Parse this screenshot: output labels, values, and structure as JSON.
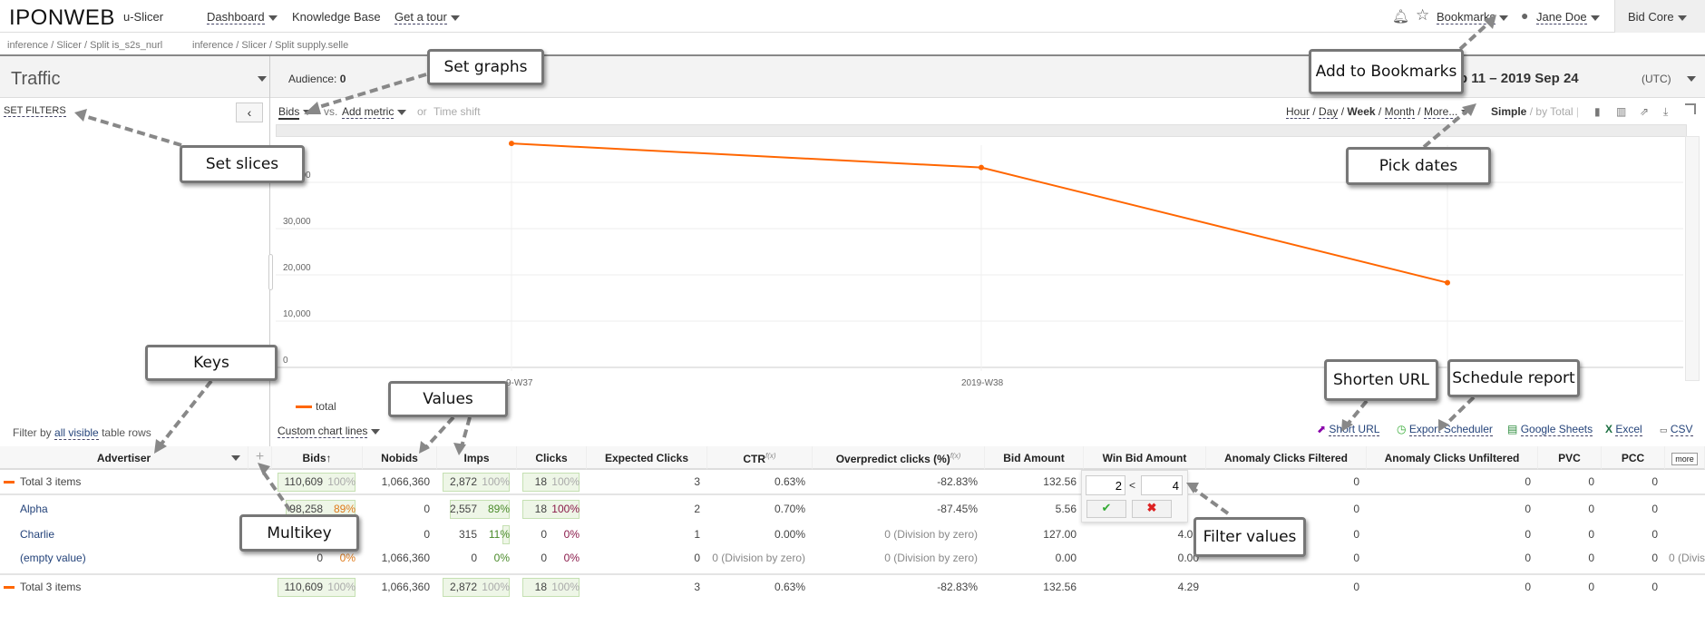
{
  "topbar": {
    "logo": "IPONWEB",
    "app": "u-Slicer",
    "dashboard": "Dashboard",
    "kb": "Knowledge Base",
    "tour": "Get a tour",
    "bookmarks": "Bookmarks",
    "user": "Jane Doe",
    "product": "Bid Core",
    "icons": [
      "bell-icon",
      "star-icon",
      "user-icon"
    ]
  },
  "breadcrumbs": [
    "inference / Slicer / Split is_s2s_nurl",
    "inference / Slicer / Split supply.selle"
  ],
  "header": {
    "title": "Traffic",
    "audience_label": "Audience:",
    "audience_value": "0",
    "date_range": "2019 Sep 11 – 2019 Sep 24",
    "tz": "(UTC)"
  },
  "controls": {
    "set_filters": "SET FILTERS",
    "metric": "Bids",
    "vs": "vs.",
    "add_metric": "Add metric",
    "or": "or",
    "time_shift": "Time shift",
    "hour": "Hour",
    "day": "Day",
    "week": "Week",
    "month": "Month",
    "more": "More...",
    "simple": "Simple",
    "by_total": "by Total",
    "sep": "/"
  },
  "chart_data": {
    "type": "line",
    "x": [
      "2019-W37",
      "2019-W38",
      "2019-W39"
    ],
    "x_tick_labels": [
      "9-W37",
      "2019-W38",
      "19"
    ],
    "series": [
      {
        "name": "total",
        "values": [
          48400,
          43200,
          18300
        ],
        "color": "#ff6600"
      }
    ],
    "yticks": [
      "0",
      "10,000",
      "20,000",
      "30,000",
      "40,000"
    ],
    "ylim": [
      0,
      50000
    ],
    "grid": true,
    "legend": "bottom-left"
  },
  "below_chart": {
    "filter_prefix": "Filter by",
    "filter_link": "all visible",
    "filter_suffix": "table rows",
    "custom_lines": "Custom chart lines",
    "short_url": "Short URL",
    "export_scheduler": "Export Scheduler",
    "google_sheets": "Google Sheets",
    "excel": "Excel",
    "csv": "CSV"
  },
  "table": {
    "columns": [
      "Advertiser",
      "+",
      "Bids↑",
      "Nobids",
      "Imps",
      "Clicks",
      "Expected Clicks",
      "CTR",
      "Overpredict clicks (%)",
      "Bid Amount",
      "Win Bid Amount",
      "Anomaly Clicks Filtered",
      "Anomaly Clicks Unfiltered",
      "PVC",
      "PCC",
      "more"
    ],
    "fx": "f(x)",
    "rows": [
      {
        "key": "Total 3 items",
        "total": true,
        "cells": [
          [
            "110,609",
            "100%",
            100,
            "#aaa"
          ],
          "1,066,360",
          [
            "2,872",
            "100%",
            100,
            "#aaa"
          ],
          [
            "18",
            "100%",
            100,
            "#aaa"
          ],
          "3",
          "0.63%",
          "-82.83%",
          "132.56",
          "",
          "0",
          "0",
          "0",
          "0",
          ""
        ]
      },
      {
        "key": "Alpha",
        "cells": [
          [
            "98,258",
            "89%",
            89,
            "#e07b1a"
          ],
          "0",
          [
            "2,557",
            "89%",
            89,
            "#4a8a2a"
          ],
          [
            "18",
            "100%",
            100,
            "#8a1a4a"
          ],
          "2",
          "0.70%",
          "-87.45%",
          "5.56",
          "",
          "0",
          "0",
          "0",
          "0",
          ""
        ]
      },
      {
        "key": "Charlie",
        "cells": [
          [
            "12,351",
            "11%",
            11,
            "#e07b1a"
          ],
          "0",
          [
            "315",
            "11%",
            11,
            "#4a8a2a"
          ],
          [
            "0",
            "0%",
            0,
            "#8a1a4a"
          ],
          "1",
          "0.00%",
          "0 (Division by zero)",
          "127.00",
          "4.09",
          "0",
          "0",
          "0",
          "0",
          ""
        ]
      },
      {
        "key": "(empty value)",
        "cells": [
          [
            "0",
            "0%",
            0,
            "#e07b1a"
          ],
          "1,066,360",
          [
            "0",
            "0%",
            0,
            "#4a8a2a"
          ],
          [
            "0",
            "0%",
            0,
            "#8a1a4a"
          ],
          "0",
          "0 (Division by zero)",
          "0 (Division by zero)",
          "0.00",
          "0.00",
          "0",
          "0",
          "0",
          "0",
          "0 (Divisio"
        ]
      },
      {
        "key": "Total 3 items",
        "total": true,
        "cells": [
          [
            "110,609",
            "100%",
            100,
            "#aaa"
          ],
          "1,066,360",
          [
            "2,872",
            "100%",
            100,
            "#aaa"
          ],
          [
            "18",
            "100%",
            100,
            "#aaa"
          ],
          "3",
          "0.63%",
          "-82.83%",
          "132.56",
          "4.29",
          "0",
          "0",
          "0",
          "0",
          ""
        ]
      }
    ]
  },
  "filter_popup": {
    "min": "2",
    "op": "<",
    "max": "4"
  },
  "callouts": {
    "set_graphs": "Set graphs",
    "bookmarks": "Add to Bookmarks",
    "slices": "Set slices",
    "dates": "Pick dates",
    "keys": "Keys",
    "values": "Values",
    "short": "Shorten URL",
    "schedule": "Schedule report",
    "multikey": "Multikey",
    "filter": "Filter values"
  },
  "colors": {
    "accent": "#ff6600",
    "link": "#24437a"
  }
}
